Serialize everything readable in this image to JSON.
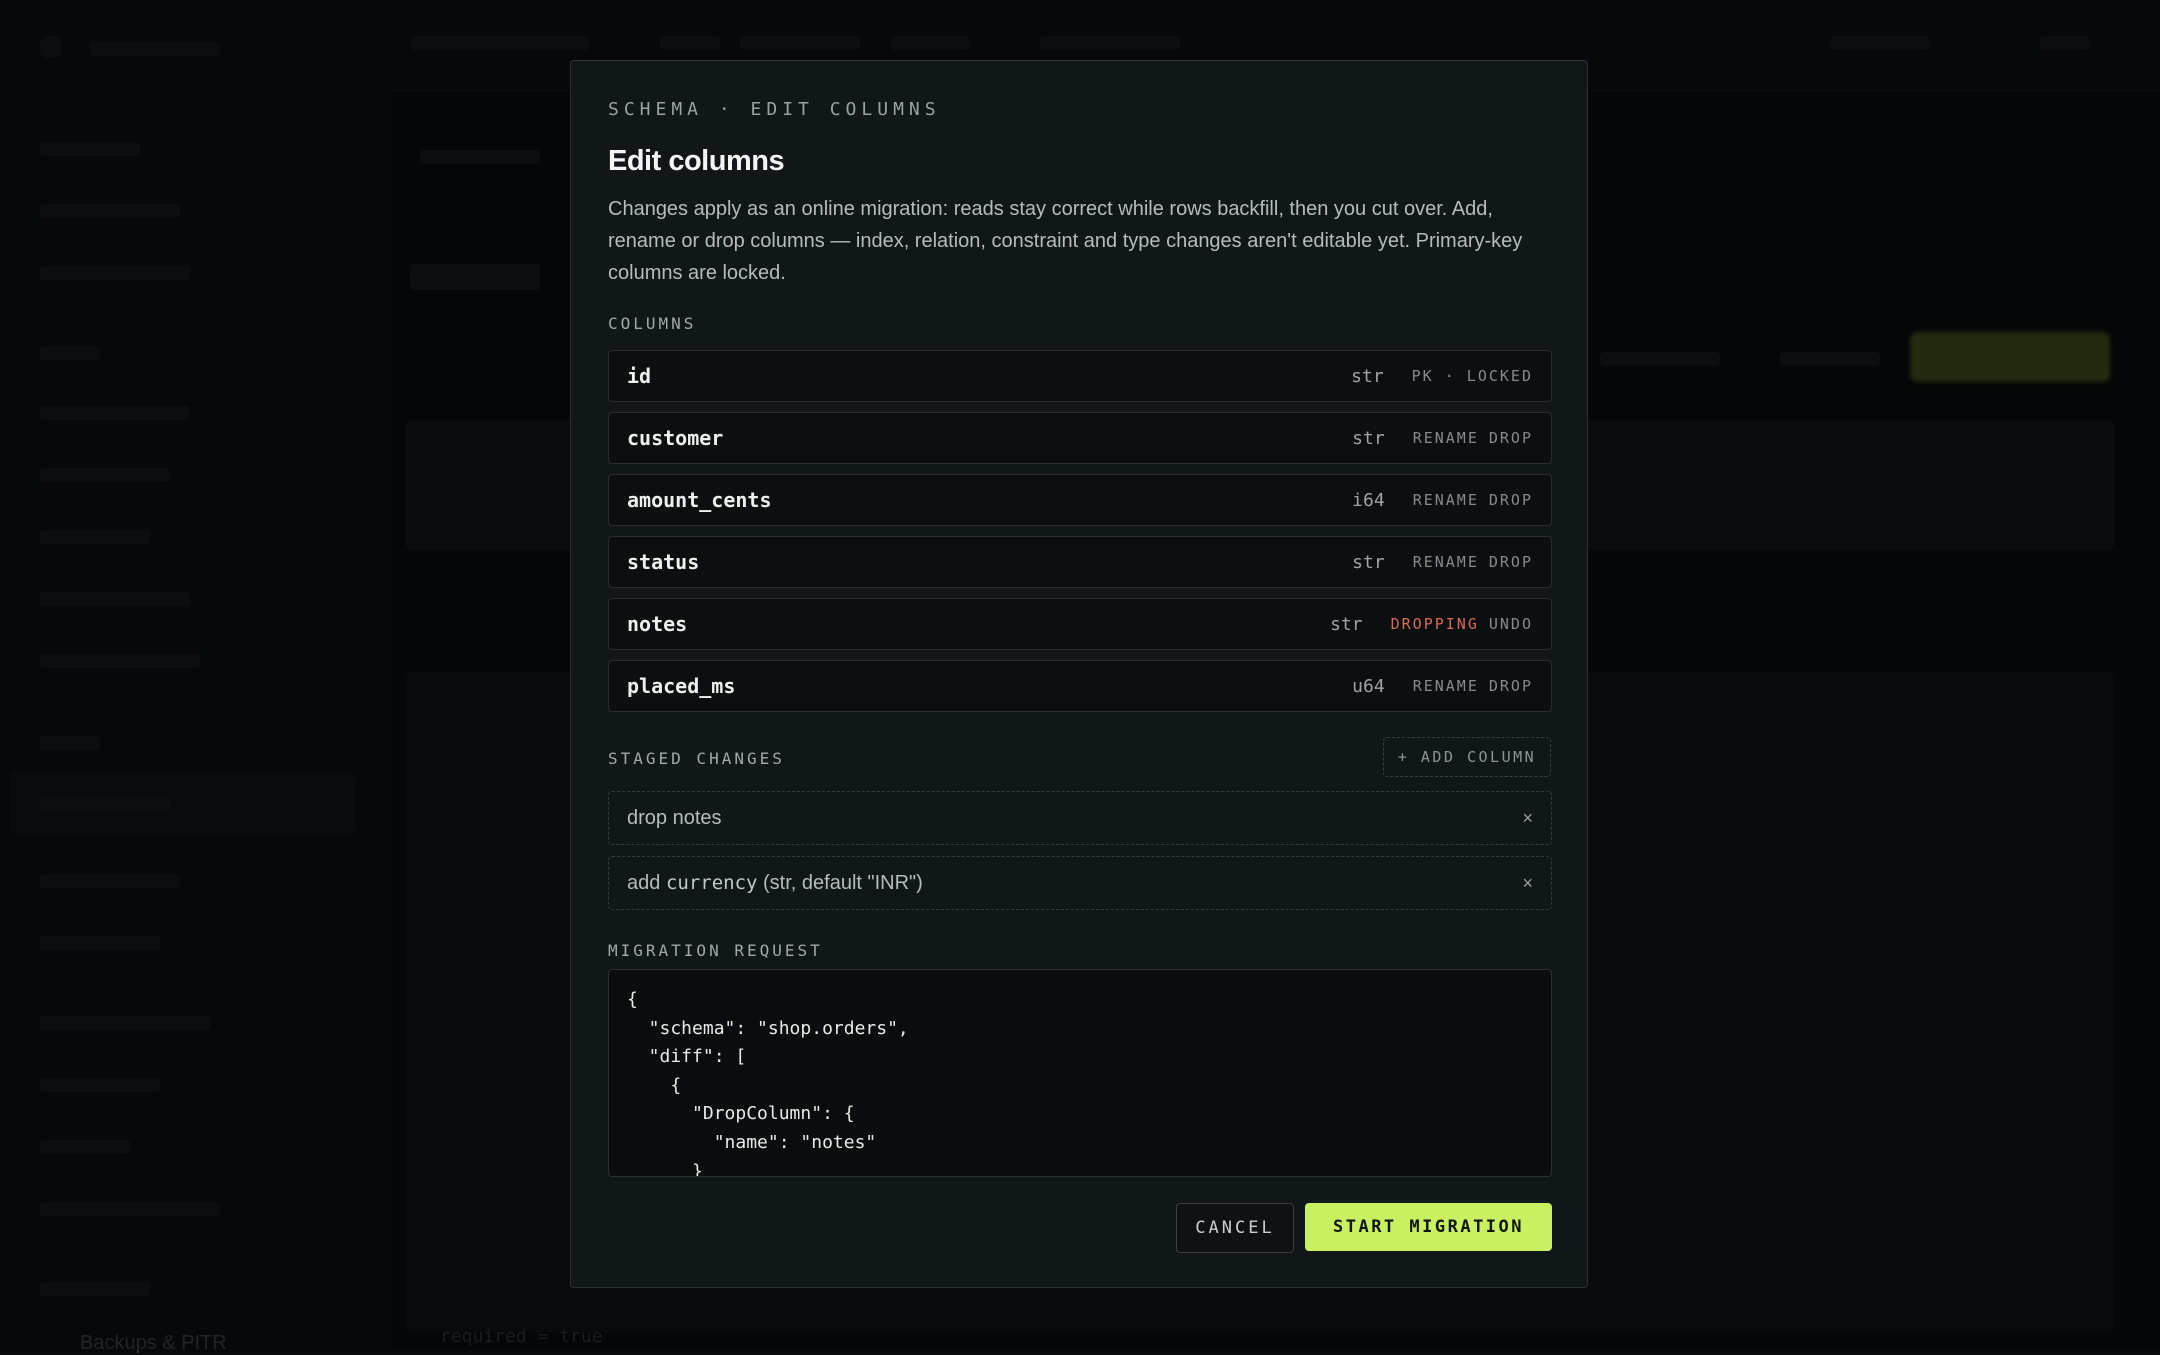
{
  "background": {
    "footer_item": "Backups & PITR",
    "footer_code": "required = true"
  },
  "modal": {
    "eyebrow": "SCHEMA · EDIT COLUMNS",
    "title": "Edit columns",
    "description": "Changes apply as an online migration: reads stay correct while rows backfill, then you cut over. Add, rename or drop columns — index, relation, constraint and type changes aren't editable yet. Primary-key columns are locked.",
    "columns_label": "COLUMNS",
    "columns": [
      {
        "name": "id",
        "type": "str",
        "actions": [
          "PK · LOCKED"
        ]
      },
      {
        "name": "customer",
        "type": "str",
        "actions": [
          "RENAME",
          "DROP"
        ]
      },
      {
        "name": "amount_cents",
        "type": "i64",
        "actions": [
          "RENAME",
          "DROP"
        ]
      },
      {
        "name": "status",
        "type": "str",
        "actions": [
          "RENAME",
          "DROP"
        ]
      },
      {
        "name": "notes",
        "type": "str",
        "actions": [
          "DROPPING",
          "UNDO"
        ]
      },
      {
        "name": "placed_ms",
        "type": "u64",
        "actions": [
          "RENAME",
          "DROP"
        ]
      }
    ],
    "staged_label": "STAGED CHANGES",
    "add_column_label": "+ ADD COLUMN",
    "staged": [
      {
        "prefix": "drop notes",
        "code": "",
        "suffix": "",
        "remove": "×"
      },
      {
        "prefix": "add ",
        "code": "currency",
        "suffix": " (str, default \"INR\")",
        "remove": "×"
      }
    ],
    "request_label": "MIGRATION REQUEST",
    "request_lines": [
      "{",
      "  \"schema\": \"shop.orders\",",
      "  \"diff\": [",
      "    {",
      "      \"DropColumn\": {",
      "        \"name\": \"notes\"",
      "      }"
    ],
    "cancel_label": "CANCEL",
    "start_label": "START MIGRATION"
  },
  "colors": {
    "accent": "#c8f060",
    "danger": "#d9675a",
    "modal_bg": "#111618"
  }
}
